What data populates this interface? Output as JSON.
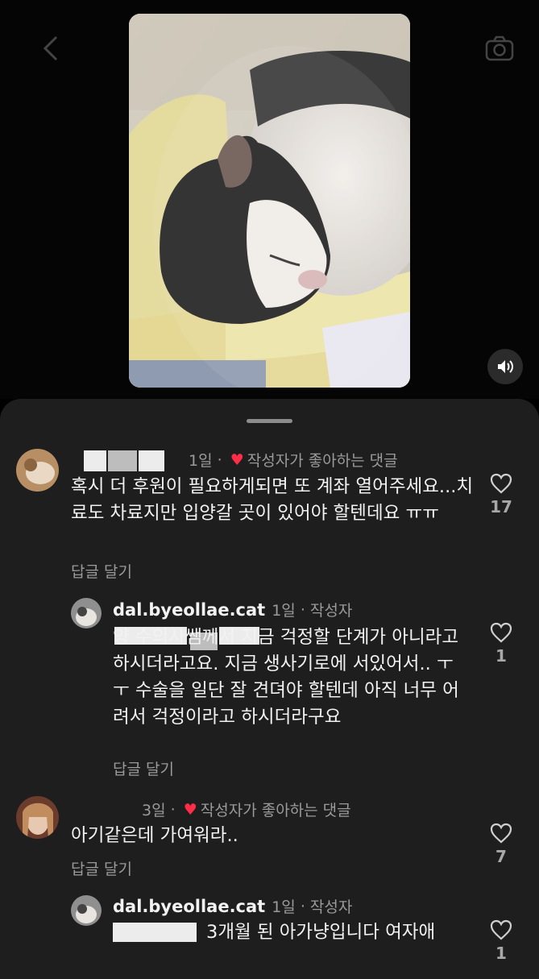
{
  "sheet": {
    "comments": [
      {
        "username": "",
        "time": "1일",
        "liked_by_author": "작성자가 좋아하는 댓글",
        "text": "혹시 더 후원이 필요하게되면 또 계좌 열어주세요...치료도 차료지만 입양갈 곳이 있어야 할텐데요 ㅠㅠ",
        "reply_label": "답글 달기",
        "likes": "17"
      },
      {
        "username": "dal.byeollae.cat",
        "time": "1일",
        "author_label": "작성자",
        "text": "양 수의사쌤께서 지금 걱정할 단계가 아니라고 하시더라고요. 지금 생사기로에 서있어서.. ㅜㅜ 수술을 일단 잘 견뎌야 할텐데 아직 너무 어려서 걱정이라고 하시더라구요",
        "reply_label": "답글 달기",
        "likes": "1"
      },
      {
        "username": "",
        "time": "3일",
        "liked_by_author": "작성자가 좋아하는 댓글",
        "text": "아기같은데 가여워라..",
        "reply_label": "답글 달기",
        "likes": "7"
      },
      {
        "username": "dal.byeollae.cat",
        "time": "1일",
        "author_label": "작성자",
        "text": "3개월 된 아가냥입니다 여자애",
        "likes": "1"
      }
    ]
  },
  "colors": {
    "background": "#000000",
    "sheet": "#1e1e1f",
    "heart": "#ff2d47",
    "secondary_text": "#9a9a9a"
  },
  "icons": [
    "back-arrow-icon",
    "camera-icon",
    "speaker-icon",
    "heart-icon",
    "heart-outline-icon"
  ]
}
